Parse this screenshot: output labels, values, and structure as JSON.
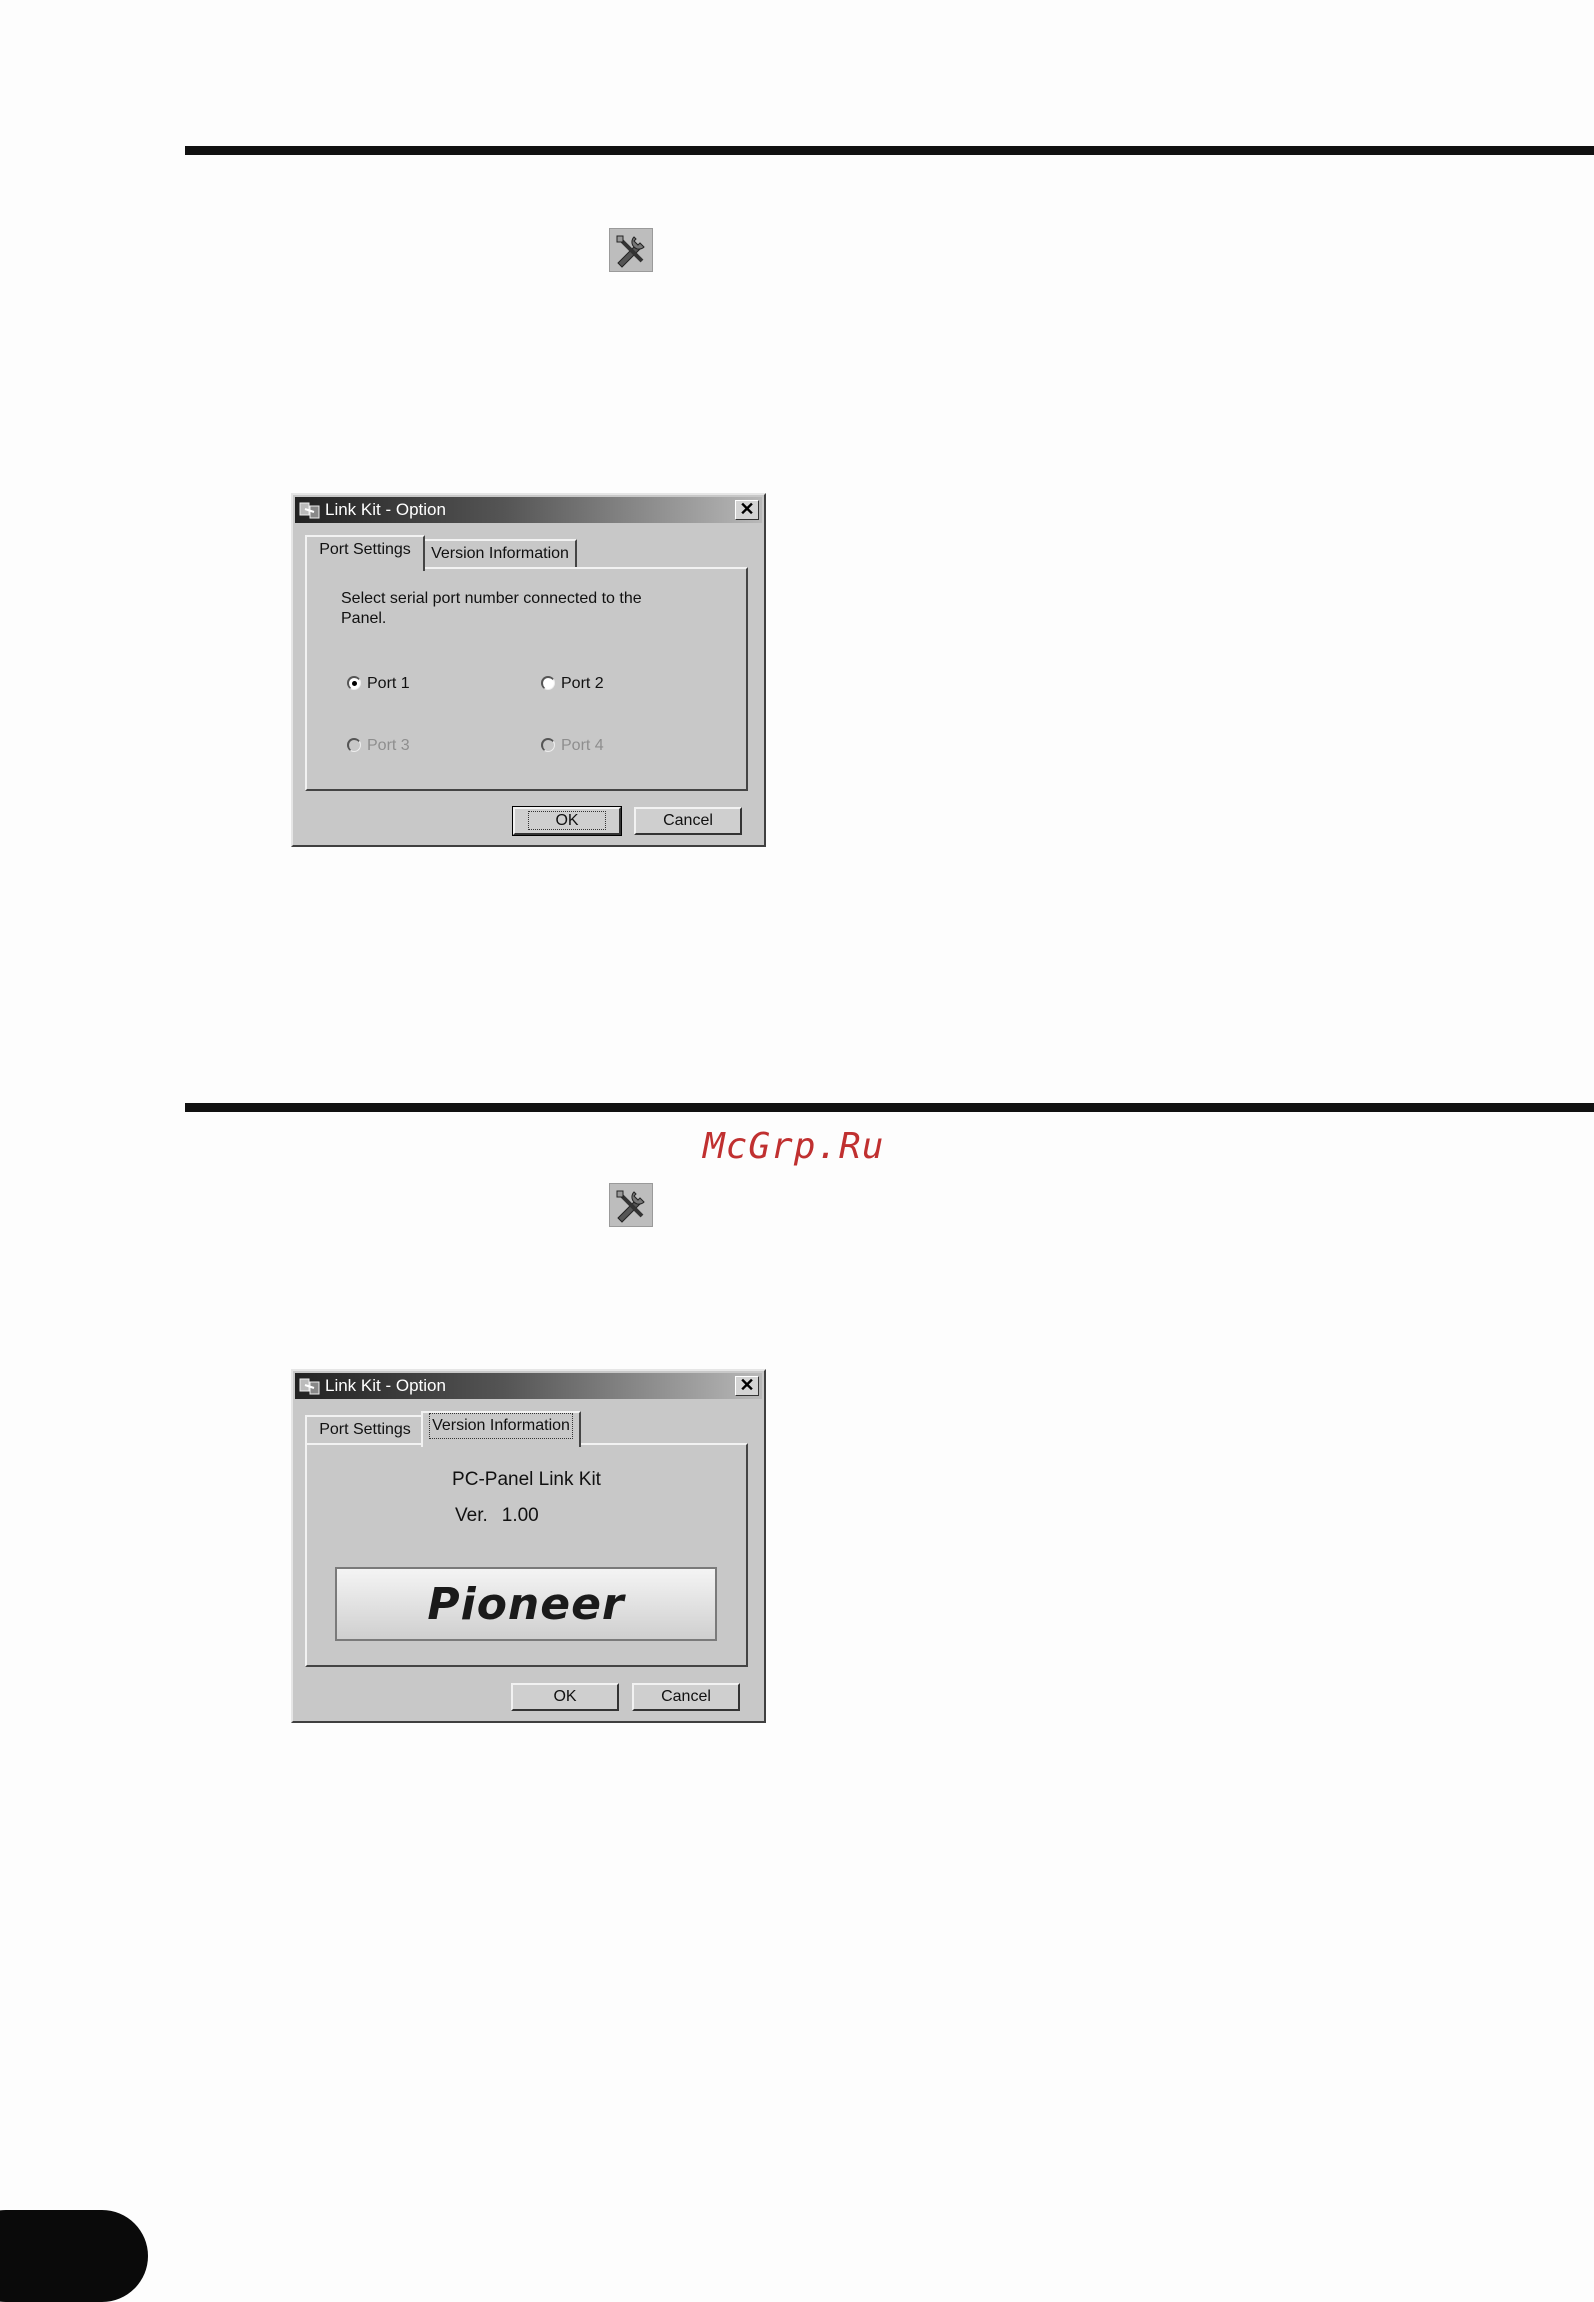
{
  "watermark": "McGrp.Ru",
  "dialog1": {
    "title": "Link Kit - Option",
    "close": "✕",
    "tabs": [
      "Port Settings",
      "Version Information"
    ],
    "active_tab": "Port Settings",
    "instruction": "Select serial port number connected to the Panel.",
    "ports": [
      {
        "label": "Port 1",
        "checked": true,
        "enabled": true
      },
      {
        "label": "Port 2",
        "checked": false,
        "enabled": true
      },
      {
        "label": "Port 3",
        "checked": false,
        "enabled": false
      },
      {
        "label": "Port 4",
        "checked": false,
        "enabled": false
      }
    ],
    "ok": "OK",
    "cancel": "Cancel"
  },
  "dialog2": {
    "title": "Link Kit - Option",
    "close": "✕",
    "tabs": [
      "Port Settings",
      "Version Information"
    ],
    "active_tab": "Version Information",
    "product": "PC-Panel Link Kit",
    "version_label": "Ver.",
    "version": "1.00",
    "logo_text": "Pioneer",
    "ok": "OK",
    "cancel": "Cancel"
  }
}
